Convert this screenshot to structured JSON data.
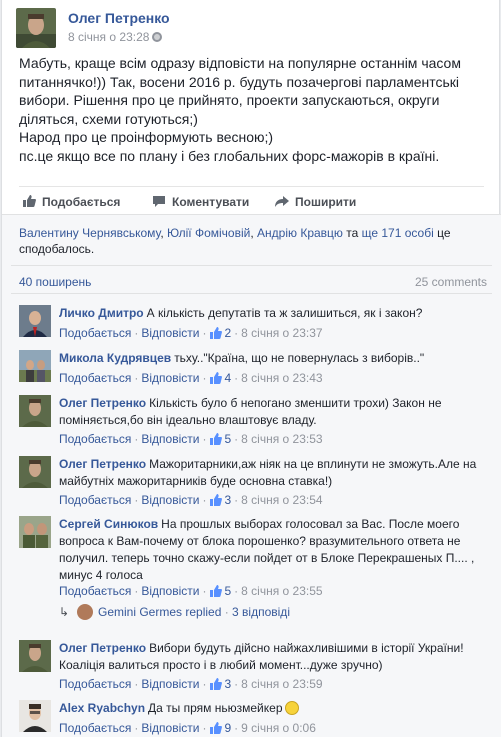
{
  "post": {
    "author": "Олег Петренко",
    "timestamp": "8 січня о 23:28",
    "body": [
      "Мабуть, краще всім одразу відповісти на популярне останнім часом питаннячко!)) Так, восени 2016 р. будуть позачергові парламентські вибори. Рішення про це прийнято, проекти запускаються, округи діляться, схеми готуються;)",
      "Народ про це проінформують весною;)",
      "пс.це якщо все по плану і без глобальних форс-мажорів в країні."
    ],
    "actions": {
      "like": "Подобається",
      "comment": "Коментувати",
      "share": "Поширити"
    }
  },
  "likes": {
    "names": [
      "Валентину Чернявському",
      "Юлії Фомічовій",
      "Андрію Кравцю"
    ],
    "sep1": ", ",
    "sep2": ", ",
    "and": " та ",
    "others": "ще 171 особі",
    "suffix": " це сподобалось."
  },
  "stats": {
    "shares": "40 поширень",
    "comments": "25 comments"
  },
  "comment_meta": {
    "like": "Подобається",
    "reply": "Відповісти"
  },
  "comments": [
    {
      "name": "Личко Дмитро",
      "text": "А кількість депутатів та ж залишиться, як і закон?",
      "likes": "2",
      "time": "8 січня о 23:37"
    },
    {
      "name": "Микола Кудрявцев",
      "text": "тьху..\"Країна, що не повернулась з виборів..\"",
      "likes": "4",
      "time": "8 січня о 23:43"
    },
    {
      "name": "Олег Петренко",
      "text": "Кількість було б непогано зменшити трохи) Закон не поміняється,бо він ідеально влаштовує владу.",
      "likes": "5",
      "time": "8 січня о 23:53"
    },
    {
      "name": "Олег Петренко",
      "text": "Мажоритарники,аж ніяк на це вплинути не зможуть.Але на майбутніх мажоритарників буде основна ставка!)",
      "likes": "3",
      "time": "8 січня о 23:54"
    },
    {
      "name": "Сергей Синюков",
      "text": "На прошлых выборах голосовал за Вас. После моего вопроса к Вам-почему от блока порошенко? вразумительного ответа не получил. теперь точно скажу-если пойдет от в Блоке Перекрашеных П.... , минус 4 голоса",
      "likes": "5",
      "time": "8 січня о 23:55"
    },
    {
      "name": "Олег Петренко",
      "text": "Вибори будуть дійсно найжахливішими в історії України!Коаліція валиться просто і в любий момент...дуже зручно)",
      "likes": "3",
      "time": "8 січня о 23:59"
    },
    {
      "name": "Alex Ryabchyn",
      "text": "Да ты прям ньюзмейкер",
      "likes": "9",
      "time": "9 січня о 0:06"
    }
  ],
  "replies": {
    "name": "Gemini Germes replied",
    "count": "3 відповіді"
  },
  "colors": {
    "link": "#365899",
    "meta": "#90949c",
    "text": "#1d2129"
  }
}
